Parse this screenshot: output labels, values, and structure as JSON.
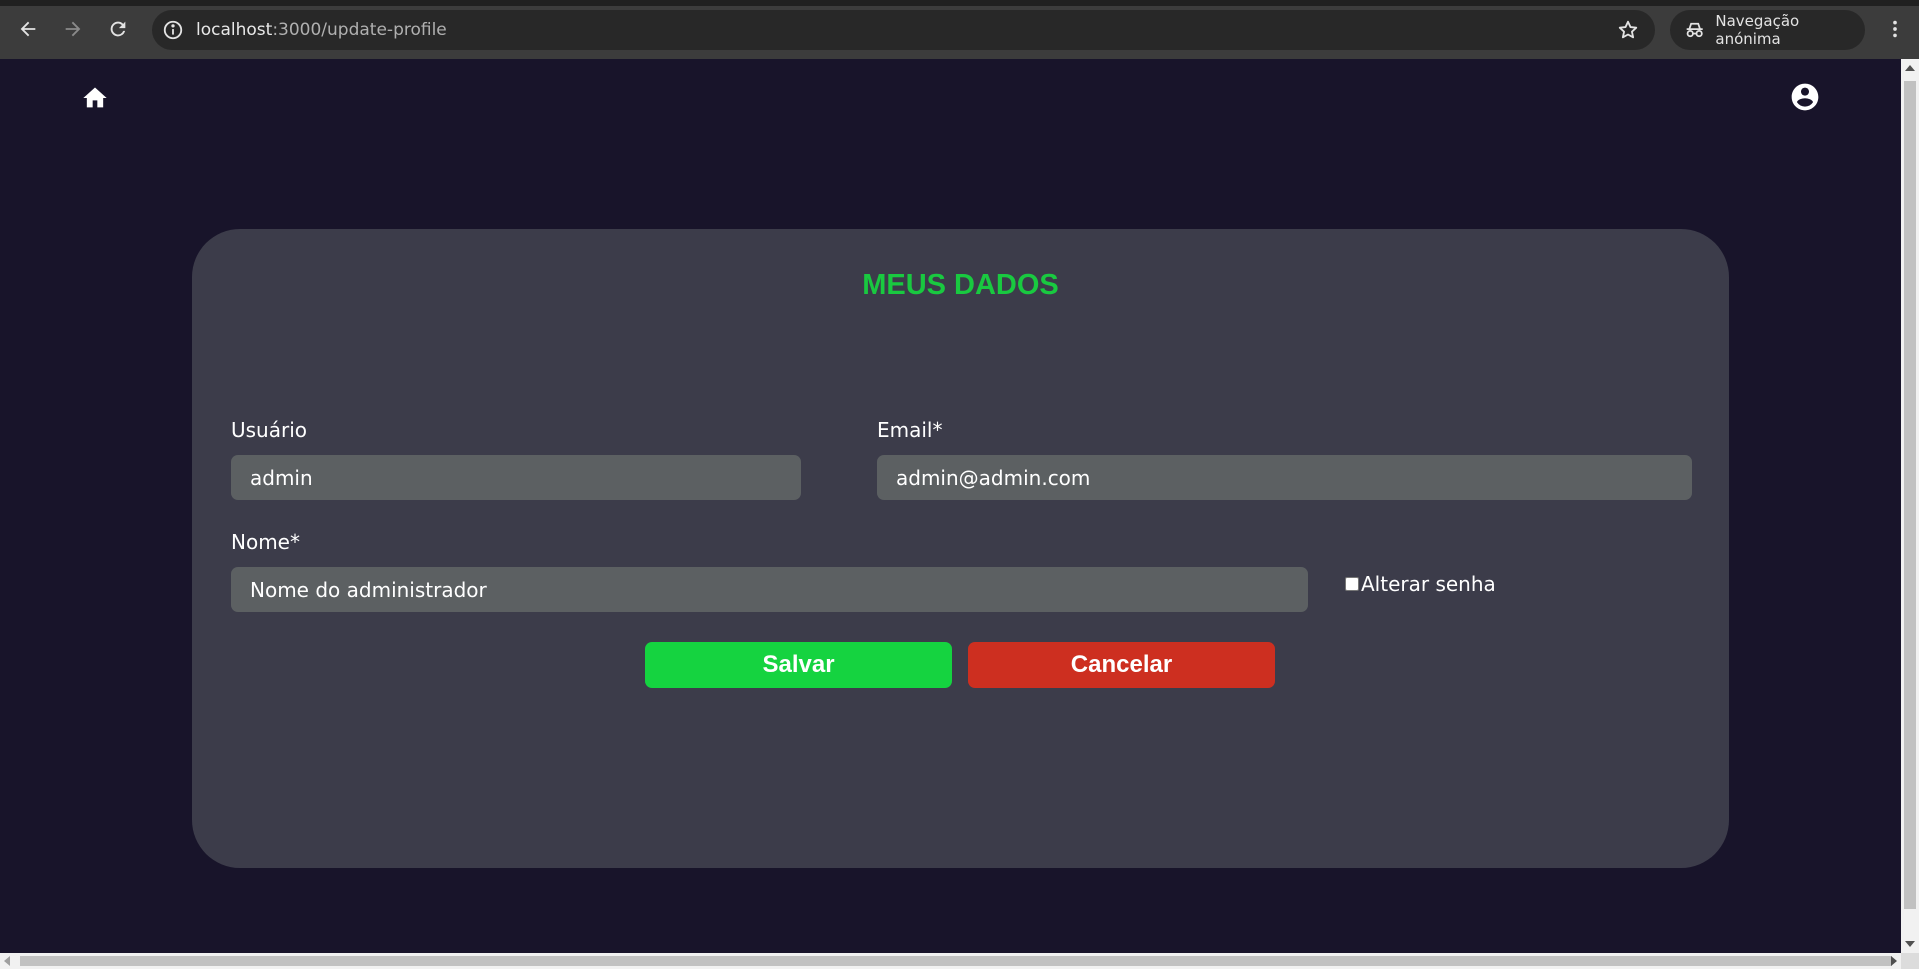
{
  "browser": {
    "url_host": "localhost",
    "url_path": ":3000/update-profile",
    "incognito_label": "Navegação anónima",
    "icons": [
      "back-icon",
      "forward-icon",
      "reload-icon",
      "info-icon",
      "star-icon",
      "incognito-icon",
      "more-vert-icon"
    ]
  },
  "header": {
    "icons": [
      "home-icon",
      "account-circle-icon"
    ]
  },
  "form": {
    "title": "MEUS DADOS",
    "usuario_label": "Usuário",
    "usuario_value": "admin",
    "email_label": "Email*",
    "email_value": "admin@admin.com",
    "nome_label": "Nome*",
    "nome_value": "Nome do administrador",
    "alterar_senha_label": "Alterar senha",
    "alterar_senha_checked": false,
    "save_label": "Salvar",
    "cancel_label": "Cancelar"
  },
  "colors": {
    "page_bg": "#18142a",
    "card_bg": "#3c3c4a",
    "input_bg": "#5c6062",
    "title_accent": "#19c940",
    "save_button": "#15d340",
    "cancel_button": "#cd2f20"
  }
}
